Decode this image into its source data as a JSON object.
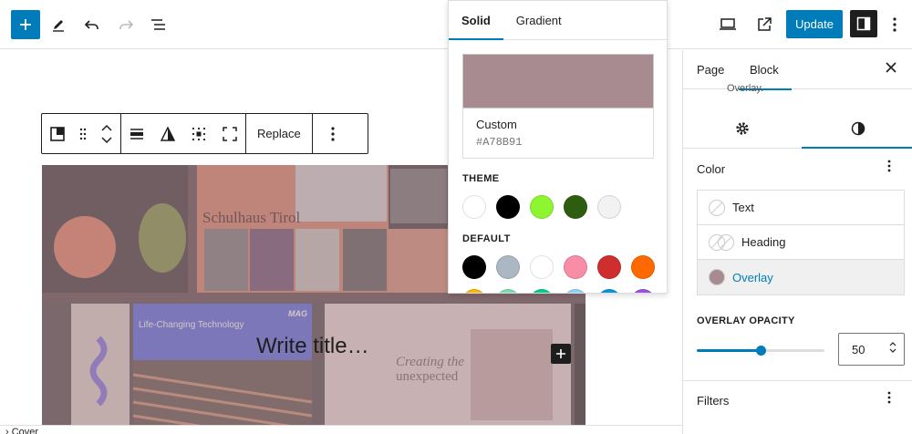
{
  "toolbar": {
    "update_label": "Update"
  },
  "block_toolbar": {
    "replace_label": "Replace"
  },
  "cover": {
    "title_placeholder": "Write title…",
    "thumb_texts": {
      "schulhaus": "Schulhaus Tirol",
      "life_changing": "Life-Changing Technology",
      "mag": "MAG",
      "creating": "Creating the unexpected"
    }
  },
  "color_popover": {
    "tabs": [
      "Solid",
      "Gradient"
    ],
    "custom_label": "Custom",
    "custom_hex": "#A78B91",
    "selected_color": "#A78B91",
    "theme_label": "THEME",
    "theme_colors": [
      "#ffffff",
      "#000000",
      "#8ef531",
      "#2f5d0f",
      "#f2f2f2"
    ],
    "default_label": "DEFAULT",
    "default_colors": [
      "#000000",
      "#abb8c3",
      "#ffffff",
      "#f78da7",
      "#cf2e2e",
      "#ff6900"
    ],
    "default_colors_row2": [
      "#fcb900",
      "#7bdcb5",
      "#00d084",
      "#8ed1fc",
      "#0693e3",
      "#9b51e0"
    ]
  },
  "sidebar": {
    "tabs": [
      "Page",
      "Block"
    ],
    "truncated_text": "Overlay.",
    "color_section": "Color",
    "color_items": [
      "Text",
      "Heading",
      "Overlay"
    ],
    "overlay_opacity_label": "OVERLAY OPACITY",
    "overlay_opacity_value": "50",
    "filters_section": "Filters"
  },
  "footer": {
    "breadcrumb": "Cover"
  },
  "colors": {
    "accent": "#007cba",
    "overlay": "#A78B91"
  }
}
